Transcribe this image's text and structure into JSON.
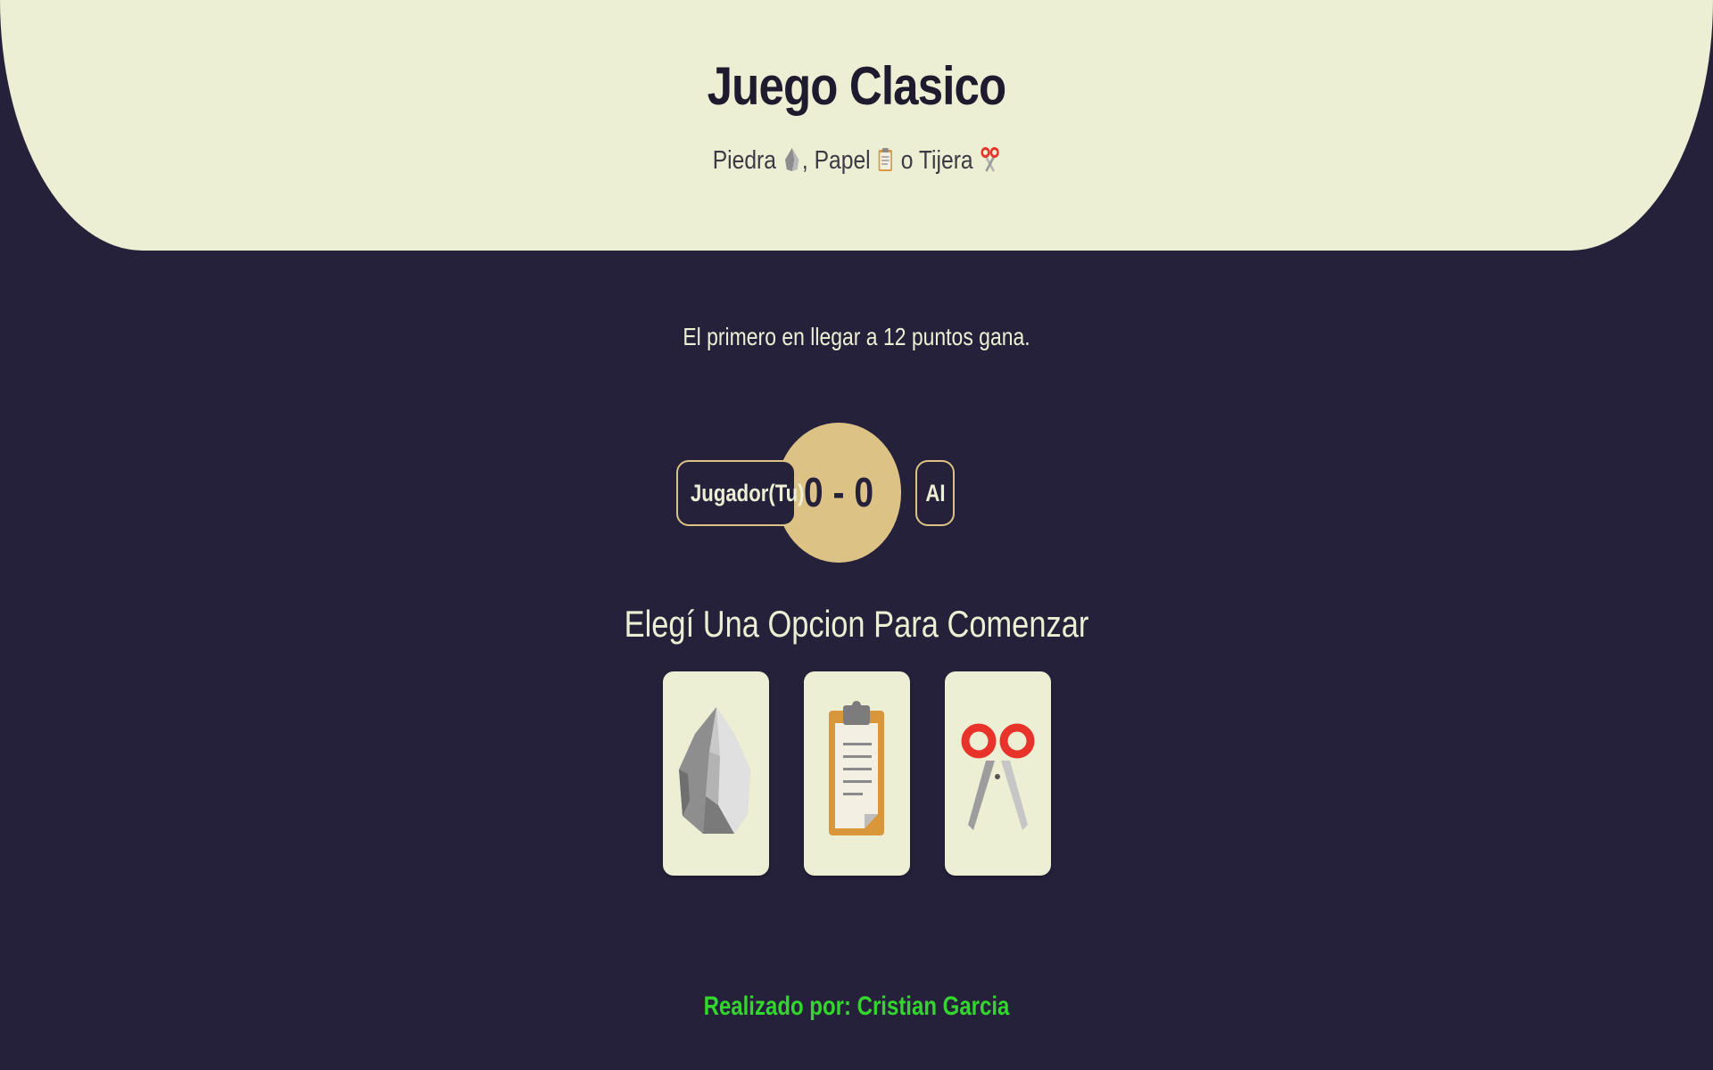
{
  "header": {
    "title": "Juego Clasico",
    "subtitle": {
      "rock_word": "Piedra",
      "paper_word": "Papel",
      "connector": "o",
      "scissors_word": "Tijera"
    }
  },
  "rules": "El primero en llegar a 12 puntos gana.",
  "scoreboard": {
    "player_label": "Jugador(Tu)",
    "score": "0 - 0",
    "ai_label": "AI",
    "player_score": 0,
    "ai_score": 0,
    "target_points": 12
  },
  "prompt": "Elegí Una Opcion Para Comenzar",
  "options": [
    {
      "id": "rock",
      "icon": "rock-icon"
    },
    {
      "id": "paper",
      "icon": "clipboard-paper-icon"
    },
    {
      "id": "scissors",
      "icon": "scissors-icon"
    }
  ],
  "footer": "Realizado por: Cristian Garcia",
  "colors": {
    "background": "#25213a",
    "header_bg": "#ecefd3",
    "score_accent": "#ddc285",
    "footer_text": "#33d62c"
  }
}
